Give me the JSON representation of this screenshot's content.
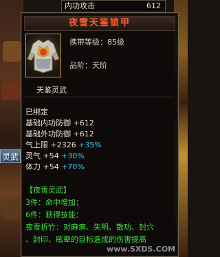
{
  "top_strip": {
    "label": "内功攻击",
    "value": "612"
  },
  "left_button": "灵武",
  "item": {
    "name": "夜雪天鉴锁甲",
    "req_level": "携带等级：85级",
    "grade": "品阶：天阶",
    "set_title": "天鉴灵武"
  },
  "stats": {
    "bound": "已绑定",
    "rows": [
      {
        "name": "基础内功防御",
        "value": "+612",
        "pct": ""
      },
      {
        "name": "基础外功防御",
        "value": "+612",
        "pct": ""
      },
      {
        "name": "气上限",
        "value": "+2326",
        "pct": "+35%"
      },
      {
        "name": "灵气",
        "value": "+54",
        "pct": "+30%"
      },
      {
        "name": "体力",
        "value": "+54",
        "pct": "+70%"
      }
    ]
  },
  "set": {
    "title": "【夜雪灵武】",
    "piece3": "3件：命中增加；",
    "piece6": "6件：获得技能：",
    "skill_desc_1": "夜雪折竹：对麻痹、失明、散功、封穴",
    "skill_desc_2": "、封印、眩晕的目标造成的伤害提高"
  },
  "watermark": "www.SXDS.COM",
  "colors": {
    "title": "#ff5a2a",
    "pct": "#3ad0ff",
    "set": "#40e040"
  }
}
